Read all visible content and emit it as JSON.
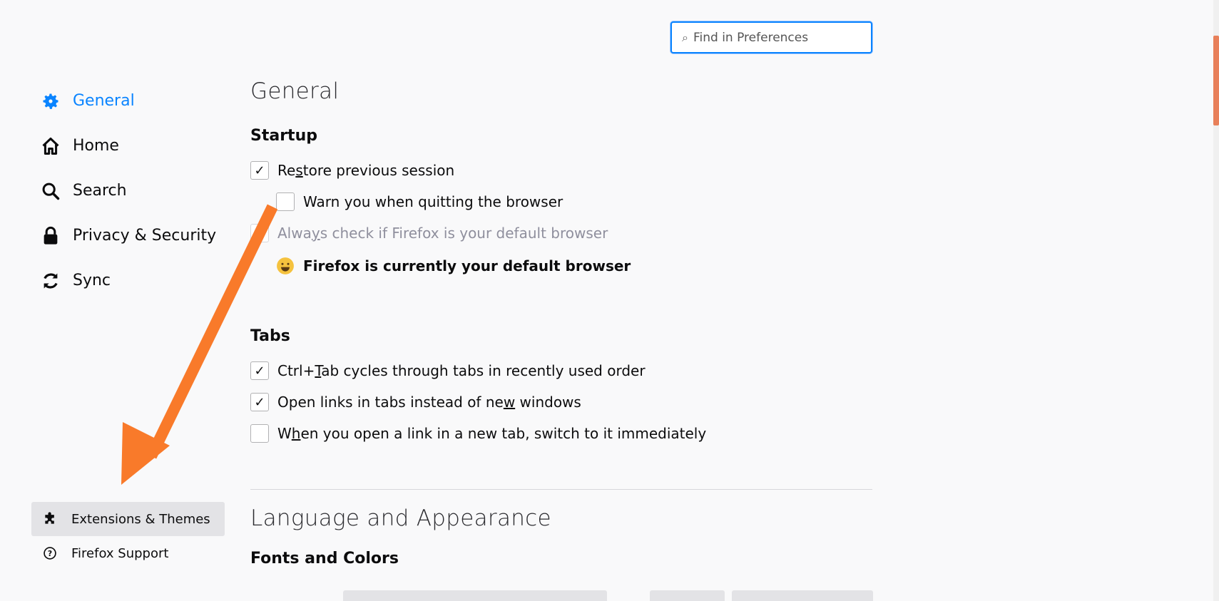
{
  "search": {
    "placeholder": "Find in Preferences"
  },
  "nav": {
    "items": [
      {
        "label": "General",
        "icon": "gear-icon",
        "active": true
      },
      {
        "label": "Home",
        "icon": "home-icon"
      },
      {
        "label": "Search",
        "icon": "search-icon"
      },
      {
        "label": "Privacy & Security",
        "icon": "lock-icon"
      },
      {
        "label": "Sync",
        "icon": "sync-icon"
      }
    ],
    "bottom": [
      {
        "label": "Extensions & Themes",
        "icon": "puzzle-icon"
      },
      {
        "label": "Firefox Support",
        "icon": "help-icon"
      }
    ]
  },
  "main": {
    "title": "General",
    "startup": {
      "heading": "Startup",
      "restore_a": "Re",
      "restore_u": "s",
      "restore_b": "tore previous session",
      "warn": "Warn you when quitting the browser",
      "always_a": "Alwa",
      "always_u": "y",
      "always_b": "s check if Firefox is your default browser",
      "default_msg": "Firefox is currently your default browser"
    },
    "tabs": {
      "heading": "Tabs",
      "ctrltab_a": "Ctrl+",
      "ctrltab_u": "T",
      "ctrltab_b": "ab cycles through tabs in recently used order",
      "openlinks_a": "Open links in tabs instead of ne",
      "openlinks_u": "w",
      "openlinks_b": " windows",
      "switch_a": "W",
      "switch_u": "h",
      "switch_b": "en you open a link in a new tab, switch to it immediately"
    },
    "language_title": "Language and Appearance",
    "fonts_heading": "Fonts and Colors"
  },
  "colors": {
    "accent": "#0a84ff",
    "arrow": "#f97a2a"
  }
}
